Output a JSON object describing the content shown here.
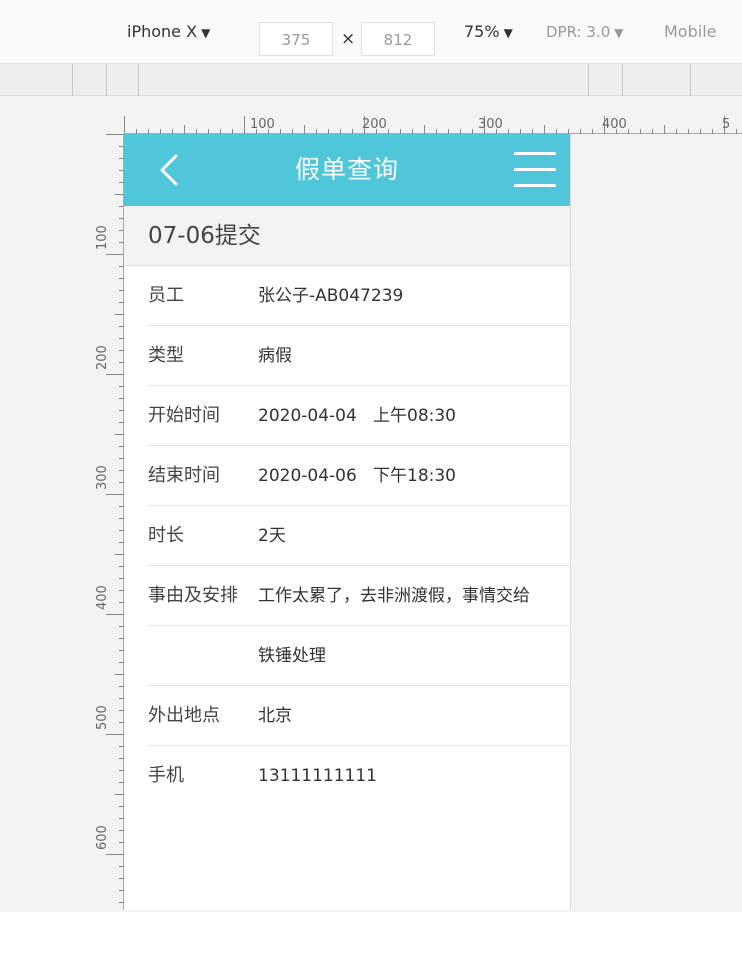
{
  "toolbar": {
    "device": "iPhone X",
    "width": "375",
    "times": "×",
    "height": "812",
    "zoom": "75%",
    "dpr": "DPR: 3.0",
    "mode": "Mobile"
  },
  "ruler": {
    "top_labels": [
      "100",
      "200",
      "300",
      "400",
      "5"
    ],
    "left_labels": [
      "100",
      "200",
      "300",
      "400",
      "500",
      "600"
    ]
  },
  "header": {
    "title": "假单查询"
  },
  "record": {
    "submitted": "07-06提交"
  },
  "fields": [
    {
      "label": "员工",
      "value": "张公子-AB047239"
    },
    {
      "label": "类型",
      "value": "病假"
    },
    {
      "label": "开始时间",
      "value": "2020-04-04   上午08:30"
    },
    {
      "label": "结束时间",
      "value": "2020-04-06   下午18:30"
    },
    {
      "label": "时长",
      "value": "2天"
    },
    {
      "label": "事由及安排",
      "value": "工作太累了，去非洲渡假，事情交给"
    },
    {
      "label": "",
      "value": "铁锤处理"
    },
    {
      "label": "外出地点",
      "value": "北京"
    },
    {
      "label": "手机",
      "value": "13111111111"
    }
  ],
  "colors": {
    "accent": "#4fc6d9"
  },
  "icons": {
    "back": "chevron-left-icon",
    "menu": "hamburger-menu-icon"
  }
}
